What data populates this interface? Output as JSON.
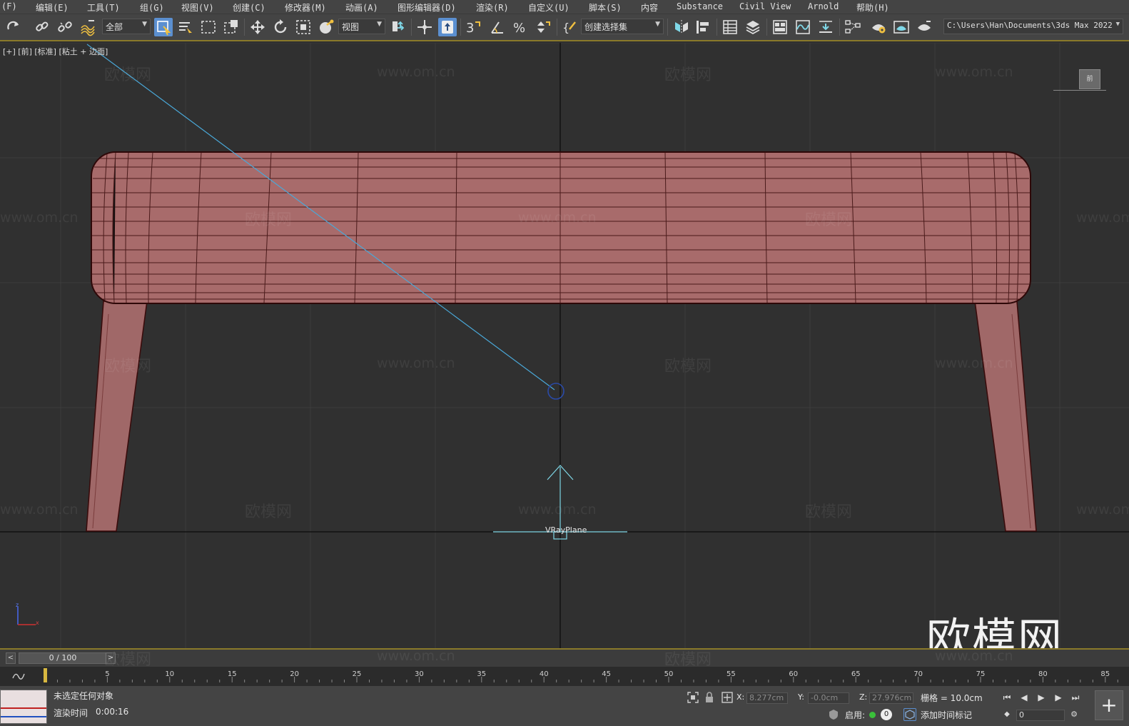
{
  "menu": [
    "(F)",
    "编辑(E)",
    "工具(T)",
    "组(G)",
    "视图(V)",
    "创建(C)",
    "修改器(M)",
    "动画(A)",
    "图形编辑器(D)",
    "渲染(R)",
    "自定义(U)",
    "脚本(S)",
    "内容",
    "Substance",
    "Civil View",
    "Arnold",
    "帮助(H)"
  ],
  "toolbar": {
    "selection_filter": "全部",
    "reference_coord": "视图",
    "selection_set": "创建选择集",
    "project_path": "C:\\Users\\Han\\Documents\\3ds Max 2022",
    "snap_toggle_label": "3",
    "icons": [
      "redo-icon",
      "link-icon",
      "unlink-icon",
      "bind-space-warp-icon",
      "select-object-icon",
      "select-by-name-icon",
      "rect-selection-icon",
      "window-crossing-icon",
      "move-icon",
      "rotate-icon",
      "scale-icon",
      "placement-icon",
      "select-manipulate-icon",
      "keyboard-shortcut-icon",
      "snap-toggle-icon",
      "angle-snap-icon",
      "percent-snap-icon",
      "spinner-snap-icon",
      "edit-named-sets-icon",
      "mirror-icon",
      "align-icon",
      "scene-explorer-icon",
      "layer-explorer-icon",
      "toggle-ribbon-icon",
      "curve-editor-icon",
      "dope-sheet-icon",
      "schematic-view-icon",
      "render-setup-icon",
      "rendered-frame-icon",
      "render-production-icon"
    ]
  },
  "viewport": {
    "label": "[+] [前] [标准] [粘土 + 边面]",
    "object_label": "VRayPlane",
    "viewcube_label": "前",
    "watermark_url": "www.om.cn",
    "watermark_cn": "欧模网",
    "watermark_big": "欧模网",
    "axis_x": "x",
    "axis_z": "z",
    "colors": {
      "background": "#303030",
      "grid": "#3e3e3e",
      "bench": "#a86a6a",
      "wire": "#3a0c0c",
      "target_line": "#4aa8d8",
      "helper": "#7fd8e8"
    }
  },
  "timeslider": {
    "value": "0 / 100",
    "prev": "<",
    "next": ">"
  },
  "trackbar": {
    "ticks": [
      5,
      10,
      15,
      20,
      25,
      30,
      35,
      40,
      45,
      50,
      55,
      60,
      65,
      70,
      75,
      80,
      85
    ]
  },
  "status": {
    "selection": "未选定任何对象",
    "render_time_label": "渲染时间",
    "render_time_value": "0:00:16",
    "x_label": "X:",
    "x_value": "8.277cm",
    "y_label": "Y:",
    "y_value": "-0.0cm",
    "z_label": "Z:",
    "z_value": "27.976cm",
    "grid_label": "栅格 = 10.0cm",
    "enable_label": "启用:",
    "enable_count": "0",
    "add_time_tag": "添加时间标记",
    "frame_value": "0"
  }
}
